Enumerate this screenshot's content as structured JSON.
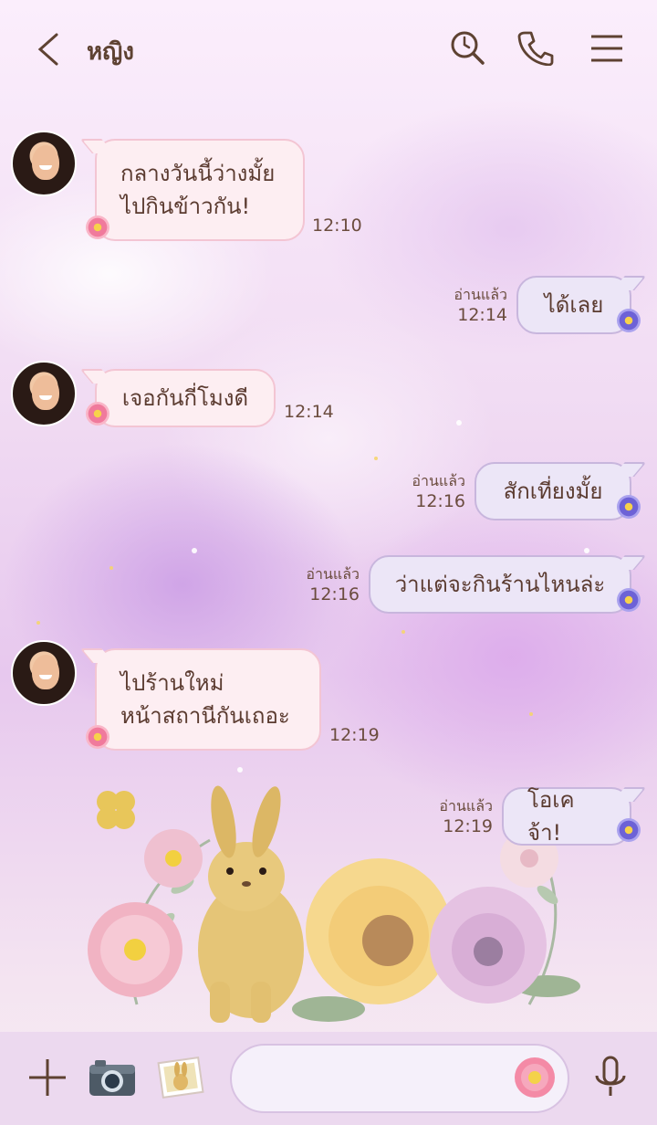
{
  "header": {
    "title": "หญิง",
    "icons": [
      "back-icon",
      "search-history-icon",
      "phone-icon",
      "menu-icon"
    ]
  },
  "messages": [
    {
      "side": "in",
      "lines": [
        "กลางวันนี้ว่างมั้ย",
        "ไปกินข้าวกัน!"
      ],
      "time": "12:10"
    },
    {
      "side": "out",
      "text": "ได้เลย",
      "read": "อ่านแล้ว",
      "time": "12:14"
    },
    {
      "side": "in",
      "text": "เจอกันกี่โมงดี",
      "time": "12:14"
    },
    {
      "side": "out",
      "text": "สักเที่ยงมั้ย",
      "read": "อ่านแล้ว",
      "time": "12:16"
    },
    {
      "side": "out",
      "text": "ว่าแต่จะกินร้านไหนล่ะ",
      "read": "อ่านแล้ว",
      "time": "12:16"
    },
    {
      "side": "in",
      "lines": [
        "ไปร้านใหม่",
        "หน้าสถานีกันเถอะ"
      ],
      "time": "12:19"
    },
    {
      "side": "out",
      "text": "โอเคจ้า!",
      "read": "อ่านแล้ว",
      "time": "12:19"
    }
  ],
  "footer": {
    "icons": [
      "plus-icon",
      "camera-icon",
      "photo-icon",
      "flower-sticker-icon",
      "microphone-icon"
    ],
    "input_value": ""
  },
  "colors": {
    "in_bubble": "#fdeef2",
    "out_bubble": "#ece6f7",
    "text": "#5b3b30",
    "footer": "#ecd9ef"
  }
}
